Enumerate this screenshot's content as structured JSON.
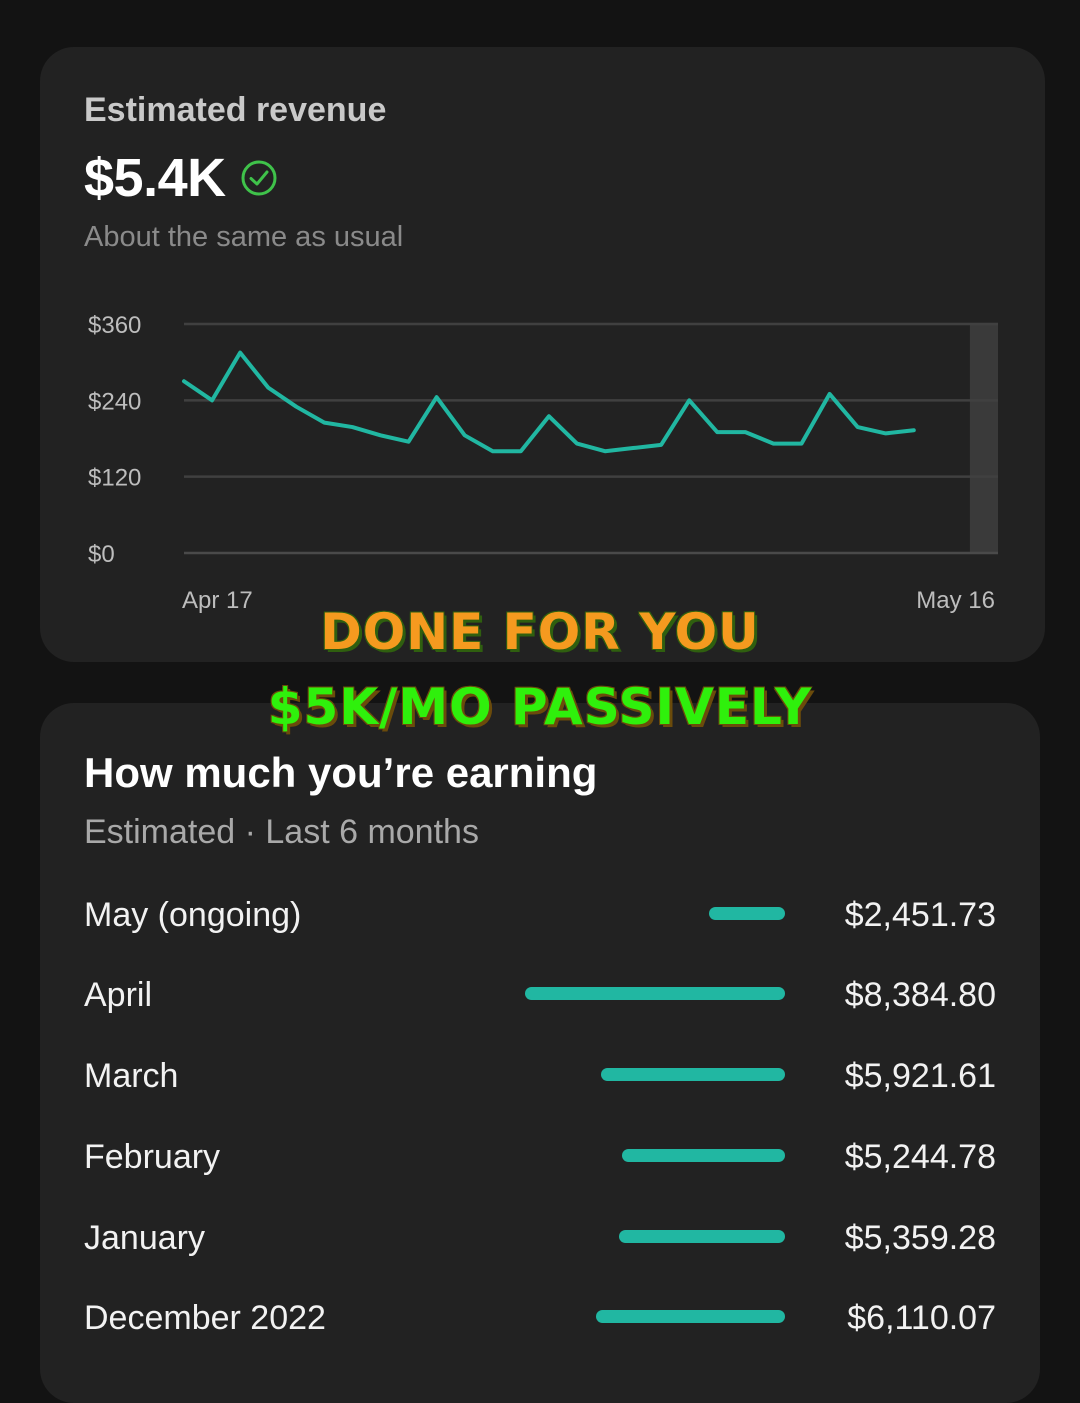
{
  "revenue_card": {
    "title": "Estimated revenue",
    "value": "$5.4K",
    "subtitle": "About the same as usual",
    "status_icon": "check-circle-icon",
    "accent_color": "#21b7a2",
    "status_color": "#3fc24a"
  },
  "chart_data": {
    "type": "line",
    "title": "",
    "xlabel": "",
    "ylabel": "",
    "x_tick_labels": [
      "Apr 17",
      "May 16"
    ],
    "y_ticks": [
      {
        "value": 360,
        "label": "$360"
      },
      {
        "value": 240,
        "label": "$240"
      },
      {
        "value": 120,
        "label": "$120"
      },
      {
        "value": 0,
        "label": "$0"
      }
    ],
    "ylim": [
      0,
      360
    ],
    "x": [
      1,
      2,
      3,
      4,
      5,
      6,
      7,
      8,
      9,
      10,
      11,
      12,
      13,
      14,
      15,
      16,
      17,
      18,
      19,
      20,
      21,
      22,
      23,
      24,
      25,
      26,
      27,
      28,
      29,
      30
    ],
    "series": [
      {
        "values": [
          270,
          240,
          315,
          260,
          230,
          205,
          198,
          185,
          175,
          245,
          185,
          160,
          160,
          215,
          172,
          160,
          165,
          170,
          240,
          190,
          190,
          172,
          172,
          250,
          198,
          188,
          193
        ]
      }
    ],
    "grid": true,
    "highlighted_region": "last day"
  },
  "earning_card": {
    "title": "How much you’re earning",
    "subtitle": "Estimated · Last 6 months",
    "rows": [
      {
        "month": "May (ongoing)",
        "amount": "$2,451.73",
        "value": 2451.73
      },
      {
        "month": "April",
        "amount": "$8,384.80",
        "value": 8384.8
      },
      {
        "month": "March",
        "amount": "$5,921.61",
        "value": 5921.61
      },
      {
        "month": "February",
        "amount": "$5,244.78",
        "value": 5244.78
      },
      {
        "month": "January",
        "amount": "$5,359.28",
        "value": 5359.28
      },
      {
        "month": "December 2022",
        "amount": "$6,110.07",
        "value": 6110.07
      }
    ]
  },
  "overlay": {
    "line1": "DONE FOR YOU",
    "line2": "$5K/MO PASSIVELY"
  }
}
